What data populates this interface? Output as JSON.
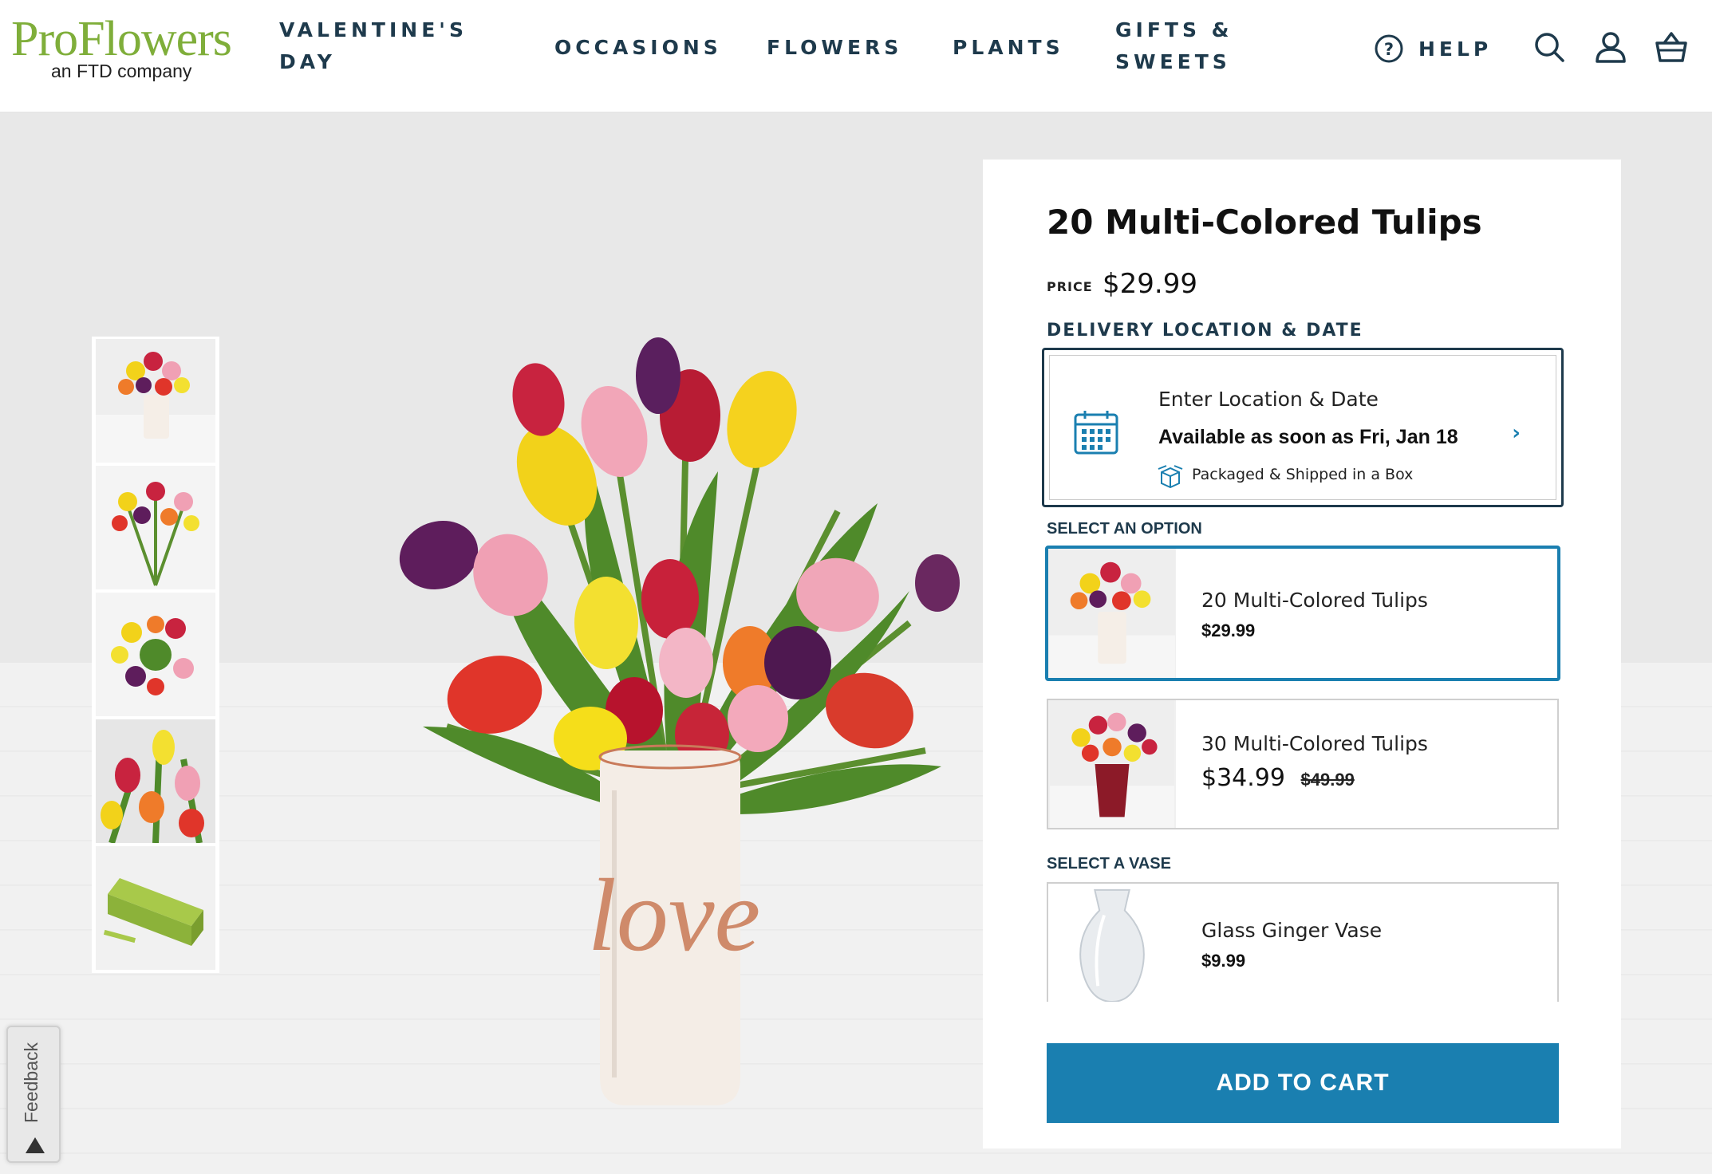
{
  "brand": {
    "logo_text": "ProFlowers",
    "tagline": "an FTD company",
    "accent_color": "#7fae3a"
  },
  "nav": {
    "items": [
      {
        "label": "VALENTINE'S DAY"
      },
      {
        "label": "OCCASIONS"
      },
      {
        "label": "FLOWERS"
      },
      {
        "label": "PLANTS"
      },
      {
        "label": "GIFTS & SWEETS"
      }
    ],
    "help_label": "HELP",
    "icons": [
      "help-circle-icon",
      "search-icon",
      "account-icon",
      "basket-icon"
    ]
  },
  "gallery": {
    "thumbnails": [
      "tulips-in-love-vase",
      "tulip-bouquet-flat",
      "tulip-bouquet-overhead",
      "tulip-closeup",
      "proflowers-box"
    ]
  },
  "product": {
    "title": "20 Multi-Colored Tulips",
    "price_label": "PRICE",
    "price": "$29.99",
    "vase_text": "love"
  },
  "delivery": {
    "section_label": "DELIVERY LOCATION & DATE",
    "title": "Enter Location & Date",
    "availability": "Available as soon as Fri, Jan 18",
    "shipping": "Packaged & Shipped in a Box",
    "chevron": "›"
  },
  "options": {
    "section_label": "SELECT AN OPTION",
    "items": [
      {
        "name": "20 Multi-Colored Tulips",
        "price": "$29.99",
        "selected": true
      },
      {
        "name": "30 Multi-Colored Tulips",
        "price": "$34.99",
        "original_price": "$49.99",
        "selected": false
      }
    ]
  },
  "vase": {
    "section_label": "SELECT A VASE",
    "items": [
      {
        "name": "Glass Ginger Vase",
        "price": "$9.99"
      }
    ]
  },
  "cta": {
    "add_to_cart": "ADD TO CART",
    "color": "#1a7fb0"
  },
  "feedback": {
    "label": "Feedback"
  }
}
